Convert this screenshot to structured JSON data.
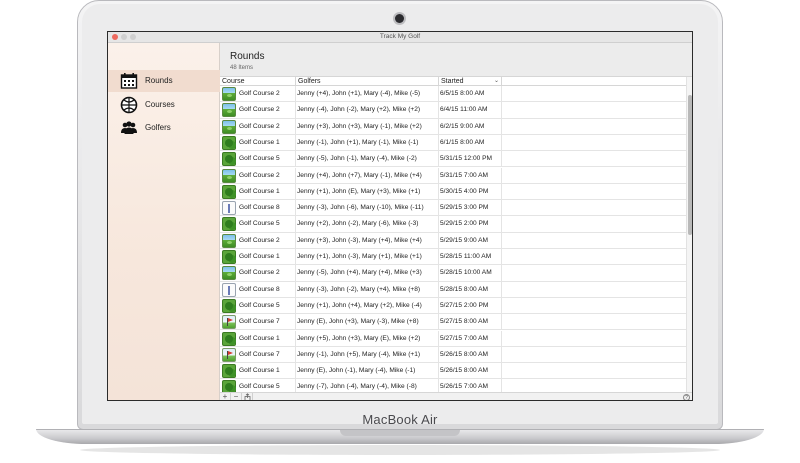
{
  "device": {
    "brand_label": "MacBook Air"
  },
  "window": {
    "title": "Track My Golf"
  },
  "sidebar": {
    "items": [
      {
        "label": "Rounds",
        "icon": "calendar-icon",
        "selected": true
      },
      {
        "label": "Courses",
        "icon": "globe-icon",
        "selected": false
      },
      {
        "label": "Golfers",
        "icon": "people-icon",
        "selected": false
      }
    ]
  },
  "header": {
    "title": "Rounds",
    "count": "48 Items"
  },
  "table": {
    "columns": [
      "Course",
      "Golfers",
      "Started"
    ],
    "sort_indicator": "⌄",
    "rows": [
      {
        "icon": "green",
        "course": "Golf Course 2",
        "golfers": "Jenny (+4), John (+1), Mary (-4), Mike (-5)",
        "started": "6/5/15 8:00 AM"
      },
      {
        "icon": "green",
        "course": "Golf Course 2",
        "golfers": "Jenny (-4), John (-2), Mary (+2), Mike (+2)",
        "started": "6/4/15 11:00 AM"
      },
      {
        "icon": "green",
        "course": "Golf Course 2",
        "golfers": "Jenny (+3), John (+3), Mary (-1), Mike (+2)",
        "started": "6/2/15 9:00 AM"
      },
      {
        "icon": "trees",
        "course": "Golf Course 1",
        "golfers": "Jenny (-1), John (+1), Mary (-1), Mike (-1)",
        "started": "6/1/15 8:00 AM"
      },
      {
        "icon": "trees",
        "course": "Golf Course 5",
        "golfers": "Jenny (-5), John (-1), Mary (-4), Mike (-2)",
        "started": "5/31/15 12:00 PM"
      },
      {
        "icon": "green",
        "course": "Golf Course 2",
        "golfers": "Jenny (+4), John (+7), Mary (-1), Mike (+4)",
        "started": "5/31/15 7:00 AM"
      },
      {
        "icon": "trees",
        "course": "Golf Course 1",
        "golfers": "Jenny (+1), John (E), Mary (+3), Mike (+1)",
        "started": "5/30/15 4:00 PM"
      },
      {
        "icon": "white",
        "course": "Golf Course 8",
        "golfers": "Jenny (-3), John (-6), Mary (-10), Mike (-11)",
        "started": "5/29/15 3:00 PM"
      },
      {
        "icon": "trees",
        "course": "Golf Course 5",
        "golfers": "Jenny (+2), John (-2), Mary (-6), Mike (-3)",
        "started": "5/29/15 2:00 PM"
      },
      {
        "icon": "green",
        "course": "Golf Course 2",
        "golfers": "Jenny (+3), John (-3), Mary (+4), Mike (+4)",
        "started": "5/29/15 9:00 AM"
      },
      {
        "icon": "trees",
        "course": "Golf Course 1",
        "golfers": "Jenny (+1), John (-3), Mary (+1), Mike (+1)",
        "started": "5/28/15 11:00 AM"
      },
      {
        "icon": "green",
        "course": "Golf Course 2",
        "golfers": "Jenny (-5), John (+4), Mary (+4), Mike (+3)",
        "started": "5/28/15 10:00 AM"
      },
      {
        "icon": "white",
        "course": "Golf Course 8",
        "golfers": "Jenny (-3), John (-2), Mary (+4), Mike (+8)",
        "started": "5/28/15 8:00 AM"
      },
      {
        "icon": "trees",
        "course": "Golf Course 5",
        "golfers": "Jenny (+1), John (+4), Mary (+2), Mike (-4)",
        "started": "5/27/15 2:00 PM"
      },
      {
        "icon": "flag",
        "course": "Golf Course 7",
        "golfers": "Jenny (E), John (+3), Mary (-3), Mike (+8)",
        "started": "5/27/15 8:00 AM"
      },
      {
        "icon": "trees",
        "course": "Golf Course 1",
        "golfers": "Jenny (+5), John (+3), Mary (E), Mike (+2)",
        "started": "5/27/15 7:00 AM"
      },
      {
        "icon": "flag",
        "course": "Golf Course 7",
        "golfers": "Jenny (-1), John (+5), Mary (-4), Mike (+1)",
        "started": "5/26/15 8:00 AM"
      },
      {
        "icon": "trees",
        "course": "Golf Course 1",
        "golfers": "Jenny (E), John (-1), Mary (-4), Mike (-1)",
        "started": "5/26/15 8:00 AM"
      },
      {
        "icon": "trees",
        "course": "Golf Course 5",
        "golfers": "Jenny (-7), John (-4), Mary (-4), Mike (-8)",
        "started": "5/26/15 7:00 AM"
      }
    ]
  },
  "bottombar": {
    "add": "+",
    "remove": "−",
    "help": "?"
  },
  "colors": {
    "selected_sidebar": "#f1dccf",
    "sidebar_bg": "#f7e7dc",
    "traffic_red": "#ee6a5f"
  }
}
